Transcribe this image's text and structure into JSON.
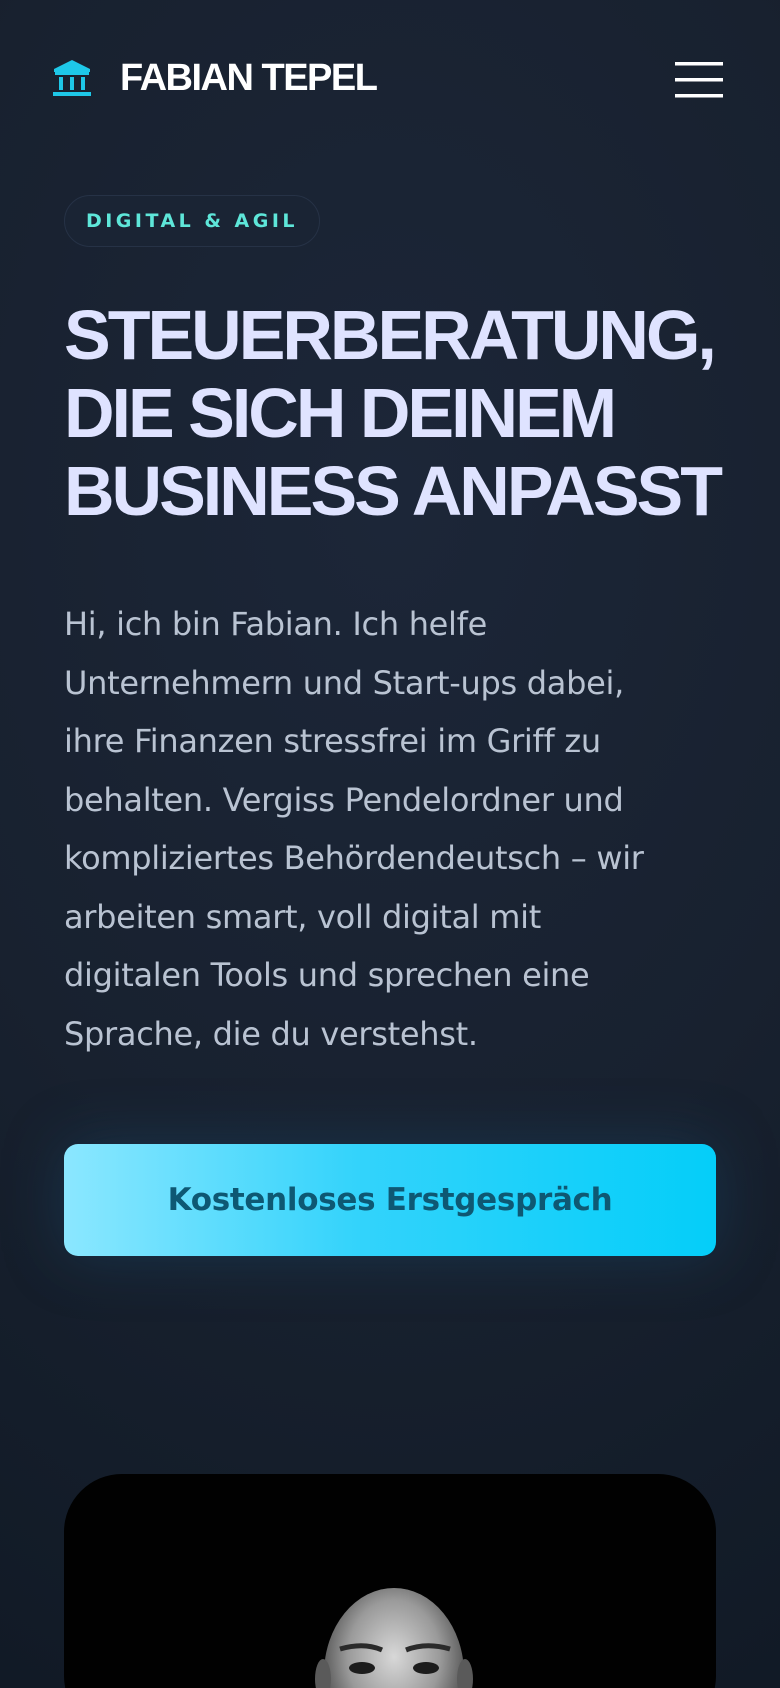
{
  "header": {
    "logo_icon": "bank-building-icon",
    "brand": "FABIAN TEPEL",
    "menu_icon": "hamburger-menu-icon"
  },
  "hero": {
    "badge": "DIGITAL & AGIL",
    "headline": [
      "STEUERBERATUNG,",
      "DIE SICH DEINEM",
      "BUSINESS ANPASST"
    ],
    "intro": [
      "Hi, ich bin Fabian. Ich helfe",
      "Unternehmern und Start-ups dabei,",
      "ihre Finanzen stressfrei im Griff zu",
      "behalten. Vergiss Pendelordner und",
      "kompliziertes Behördendeutsch – wir",
      "arbeiten smart, voll digital mit",
      "digitalen Tools und sprechen eine",
      "Sprache, die du verstehst."
    ],
    "cta_label": "Kostenloses Erstgespräch"
  },
  "portrait": {
    "image": "portrait-photo"
  },
  "colors": {
    "background": "#18212f",
    "accent_cyan": "#1ec8e8",
    "badge_text": "#5ee6d9",
    "headline": "#dfe3ff",
    "body_text": "#b9c3d2",
    "cta_gradient_start": "#8be7ff",
    "cta_gradient_end": "#04cef9",
    "cta_text": "#0e5873"
  }
}
